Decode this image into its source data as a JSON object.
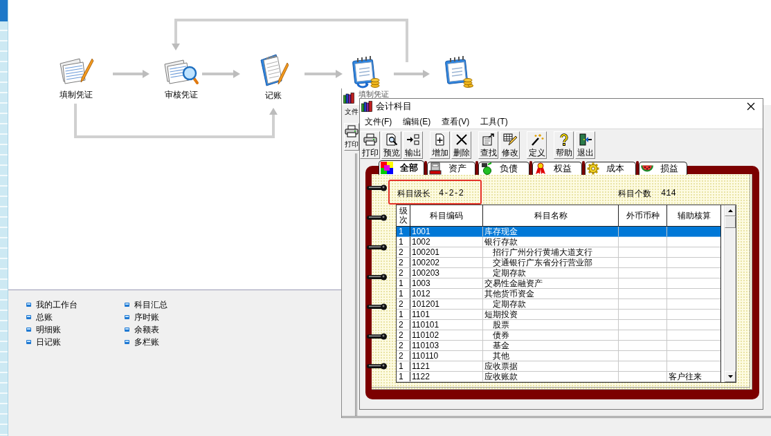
{
  "workflow": {
    "steps": [
      {
        "kind": "fill",
        "label": "填制凭证"
      },
      {
        "kind": "audit",
        "label": "审核凭证"
      },
      {
        "kind": "post",
        "label": "记账"
      },
      {
        "kind": "calendar_cycle"
      },
      {
        "kind": "calendar_coins"
      }
    ]
  },
  "shortcut_columns": [
    [
      "我的工作台",
      "总账",
      "明细账",
      "日记账"
    ],
    [
      "科目汇总",
      "序时账",
      "余额表",
      "多栏账"
    ]
  ],
  "background_window": {
    "title": "填制凭证",
    "menu": [
      "文件"
    ],
    "toolbar": [
      {
        "kind": "print",
        "label": "打印"
      }
    ]
  },
  "dialog": {
    "title": "会计科目",
    "menu": [
      "文件(F)",
      "编辑(E)",
      "查看(V)",
      "工具(T)"
    ],
    "toolbar": [
      [
        {
          "kind": "print",
          "label": "打印"
        },
        {
          "kind": "preview",
          "label": "预览"
        },
        {
          "kind": "export",
          "label": "输出"
        }
      ],
      [
        {
          "kind": "add",
          "label": "增加"
        },
        {
          "kind": "delete",
          "label": "删除"
        }
      ],
      [
        {
          "kind": "find",
          "label": "查找"
        },
        {
          "kind": "edit",
          "label": "修改"
        }
      ],
      [
        {
          "kind": "define",
          "label": "定义"
        }
      ],
      [
        {
          "kind": "help",
          "label": "帮助"
        },
        {
          "kind": "exit",
          "label": "退出"
        }
      ]
    ],
    "tabs": [
      {
        "kind": "all",
        "label": "全部",
        "selected": true
      },
      {
        "kind": "assets",
        "label": "资产",
        "selected": false
      },
      {
        "kind": "liabilities",
        "label": "负债",
        "selected": false
      },
      {
        "kind": "equity",
        "label": "权益",
        "selected": false
      },
      {
        "kind": "cost",
        "label": "成本",
        "selected": false
      },
      {
        "kind": "profit",
        "label": "损益",
        "selected": false
      }
    ],
    "summary": {
      "level_length_label": "科目级长",
      "level_length": "4-2-2",
      "highlighted": true,
      "count_label": "科目个数",
      "count": "414"
    },
    "table": {
      "columns": [
        "级次",
        "科目编码",
        "科目名称",
        "外币币种",
        "辅助核算"
      ],
      "rows": [
        {
          "level": "1",
          "code": "1001",
          "name": "库存现金",
          "selected": true
        },
        {
          "level": "1",
          "code": "1002",
          "name": "银行存款",
          "selected": false,
          "children": [
            {
              "level": "2",
              "code": "100201",
              "name": "招行广州分行黄埔大道支行",
              "selected": false
            },
            {
              "level": "2",
              "code": "100202",
              "name": "交通银行广东省分行营业部",
              "selected": false
            },
            {
              "level": "2",
              "code": "100203",
              "name": "定期存款",
              "selected": false
            }
          ]
        },
        {
          "level": "1",
          "code": "1003",
          "name": "交易性金融资产",
          "selected": false
        },
        {
          "level": "1",
          "code": "1012",
          "name": "其他货币资金",
          "selected": false,
          "children": [
            {
              "level": "2",
              "code": "101201",
              "name": "定期存款",
              "selected": false
            }
          ]
        },
        {
          "level": "1",
          "code": "1101",
          "name": "短期投资",
          "selected": false,
          "children": [
            {
              "level": "2",
              "code": "110101",
              "name": "股票",
              "selected": false
            },
            {
              "level": "2",
              "code": "110102",
              "name": "债券",
              "selected": false
            },
            {
              "level": "2",
              "code": "110103",
              "name": "基金",
              "selected": false
            },
            {
              "level": "2",
              "code": "110110",
              "name": "其他",
              "selected": false
            }
          ]
        },
        {
          "level": "1",
          "code": "1121",
          "name": "应收票据",
          "selected": false
        },
        {
          "level": "1",
          "code": "1122",
          "name": "应收账款",
          "aux": "客户往来",
          "selected": false
        }
      ]
    }
  }
}
